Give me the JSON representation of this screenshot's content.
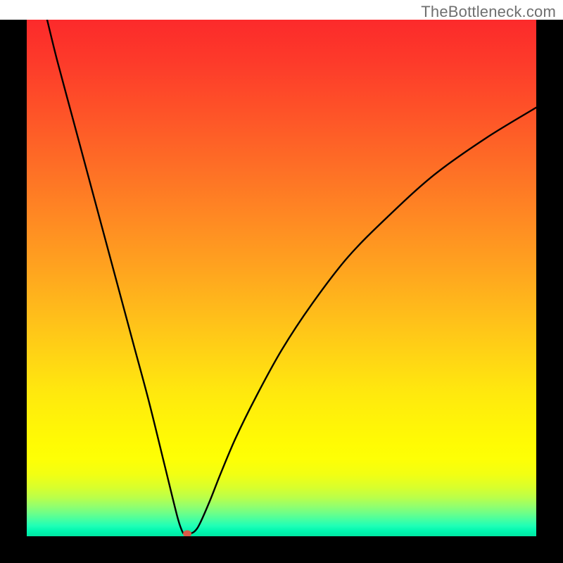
{
  "watermark": "TheBottleneck.com",
  "chart_data": {
    "type": "line",
    "title": "",
    "xlabel": "",
    "ylabel": "",
    "xlim": [
      0,
      100
    ],
    "ylim": [
      0,
      100
    ],
    "gradient_stops": [
      {
        "offset": 0.0,
        "color": "#fc2a2b"
      },
      {
        "offset": 0.08,
        "color": "#fd3a2a"
      },
      {
        "offset": 0.18,
        "color": "#fe5328"
      },
      {
        "offset": 0.28,
        "color": "#fe6d26"
      },
      {
        "offset": 0.38,
        "color": "#ff8823"
      },
      {
        "offset": 0.48,
        "color": "#ffa31f"
      },
      {
        "offset": 0.58,
        "color": "#ffc01a"
      },
      {
        "offset": 0.66,
        "color": "#ffd714"
      },
      {
        "offset": 0.72,
        "color": "#ffe80e"
      },
      {
        "offset": 0.78,
        "color": "#fff408"
      },
      {
        "offset": 0.82,
        "color": "#fffb04"
      },
      {
        "offset": 0.85,
        "color": "#feff05"
      },
      {
        "offset": 0.88,
        "color": "#f2ff13"
      },
      {
        "offset": 0.905,
        "color": "#d9ff2c"
      },
      {
        "offset": 0.925,
        "color": "#baff4a"
      },
      {
        "offset": 0.94,
        "color": "#97ff6a"
      },
      {
        "offset": 0.955,
        "color": "#6eff88"
      },
      {
        "offset": 0.968,
        "color": "#45ffa2"
      },
      {
        "offset": 0.98,
        "color": "#1effb6"
      },
      {
        "offset": 0.99,
        "color": "#00f7b0"
      },
      {
        "offset": 1.0,
        "color": "#00e6a2"
      }
    ],
    "series": [
      {
        "name": "curve",
        "x": [
          4,
          6,
          9,
          12,
          15,
          18,
          21,
          24,
          27,
          29.5,
          30.5,
          31,
          32,
          33,
          34,
          36,
          38,
          41,
          45,
          50,
          56,
          63,
          71,
          80,
          90,
          100
        ],
        "y": [
          100,
          92,
          81,
          70,
          59,
          48,
          37,
          26,
          14,
          4,
          1,
          0.5,
          0.5,
          1,
          2.5,
          7,
          12,
          19,
          27,
          36,
          45,
          54,
          62,
          70,
          77,
          83
        ]
      }
    ],
    "marker": {
      "x": 31.5,
      "y": 0.5,
      "color": "#d85a48",
      "rx": 6,
      "ry": 5
    }
  }
}
